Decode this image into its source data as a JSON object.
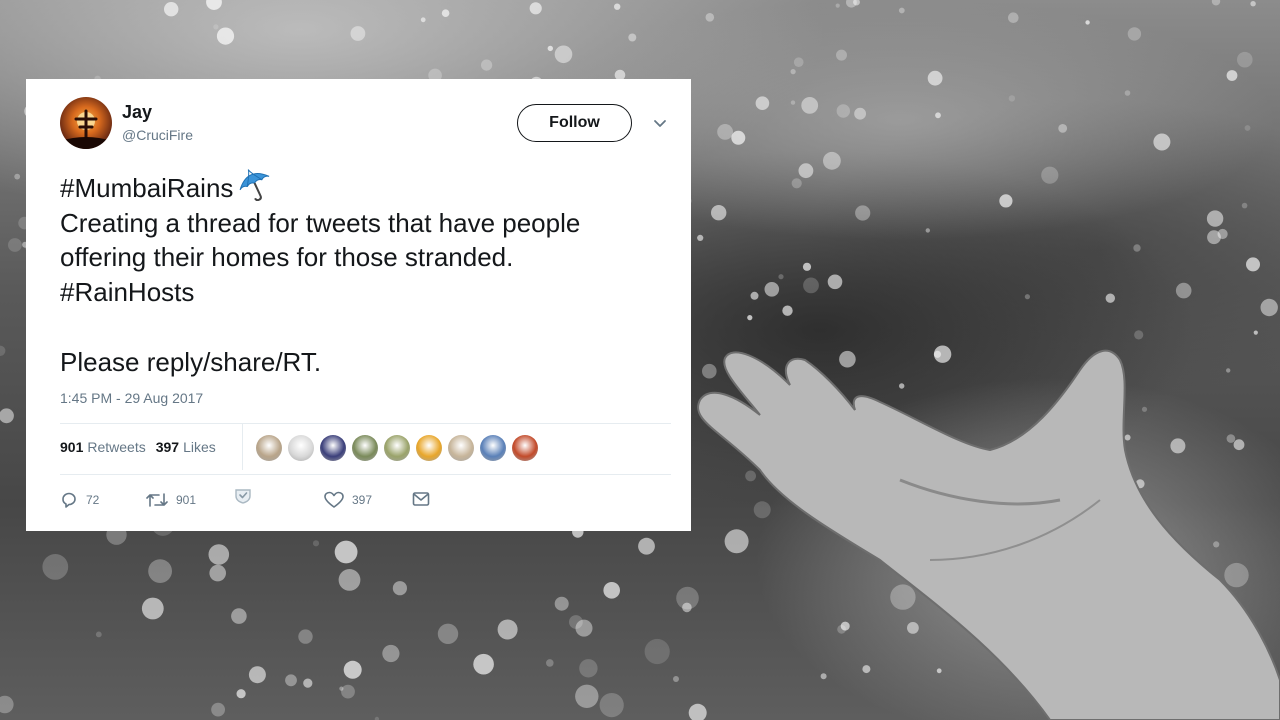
{
  "tweet": {
    "author": {
      "name": "Jay",
      "handle": "@CruciFire"
    },
    "follow_label": "Follow",
    "lines": [
      "#MumbaiRains",
      "Creating a thread for tweets that have people",
      "offering their homes for those stranded.",
      "#RainHosts",
      "Please reply/share/RT."
    ],
    "timestamp": "1:45 PM - 29 Aug 2017",
    "stats": {
      "retweets_count": "901",
      "retweets_label": "Retweets",
      "likes_count": "397",
      "likes_label": "Likes"
    },
    "liker_avatar_colors": [
      "#b9a58a",
      "#d9d9d9",
      "#3b3f7a",
      "#7a8a5a",
      "#9aa36a",
      "#e8a62a",
      "#c7b59a",
      "#5a80b8",
      "#c24a2a"
    ],
    "actions": {
      "replies": "72",
      "retweets": "901",
      "likes": "397"
    },
    "icons": [
      "caret-down-icon",
      "umbrella-icon",
      "reply-icon",
      "retweet-icon",
      "heart-icon",
      "mail-icon",
      "verified-shield-icon"
    ]
  }
}
